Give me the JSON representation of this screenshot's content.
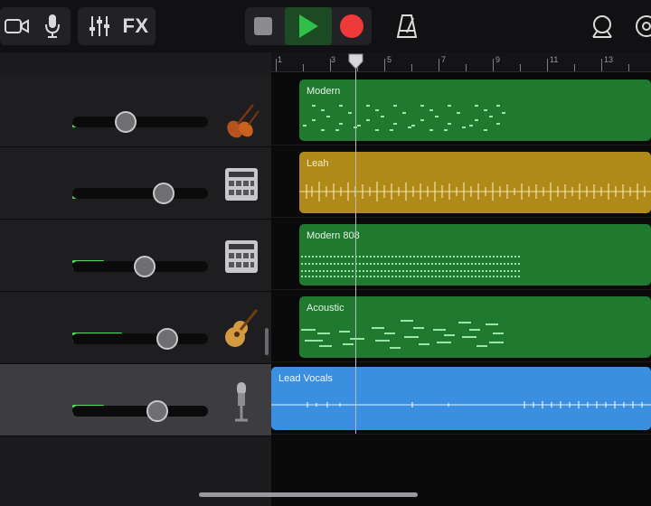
{
  "toolbar": {
    "fx_label": "FX",
    "buttons": [
      "camera-icon",
      "microphone-icon",
      "mixer-icon",
      "fx-button",
      "stop-button",
      "play-button",
      "record-button",
      "metronome-icon",
      "loop-icon",
      "settings-icon"
    ],
    "colors": {
      "play": "#2fbf4a",
      "record": "#f03a3a",
      "stop": "#8c8c90"
    }
  },
  "tracks": [
    {
      "instrument": "violin-icon",
      "level": 0.1,
      "volume": 0.39
    },
    {
      "instrument": "drum-machine-icon",
      "level": 0.1,
      "volume": 0.67
    },
    {
      "instrument": "drum-machine-icon",
      "level": 0.23,
      "volume": 0.53
    },
    {
      "instrument": "acoustic-guitar-icon",
      "level": 0.37,
      "volume": 0.7,
      "selected": false
    },
    {
      "instrument": "microphone-icon",
      "level": 0.23,
      "volume": 0.63,
      "selected": true
    }
  ],
  "timeline": {
    "bar_numbers": [
      "1",
      "3",
      "5",
      "7",
      "9",
      "11",
      "13"
    ],
    "regions": [
      {
        "name": "Modern",
        "color": "#1f7a2f"
      },
      {
        "name": "Leah",
        "color": "#b08a19"
      },
      {
        "name": "Modern 808",
        "color": "#1f7a2f"
      },
      {
        "name": "Acoustic",
        "color": "#1f7a2f"
      },
      {
        "name": "Lead Vocals",
        "color": "#3a8fe0"
      }
    ]
  },
  "add_track_label": "+"
}
